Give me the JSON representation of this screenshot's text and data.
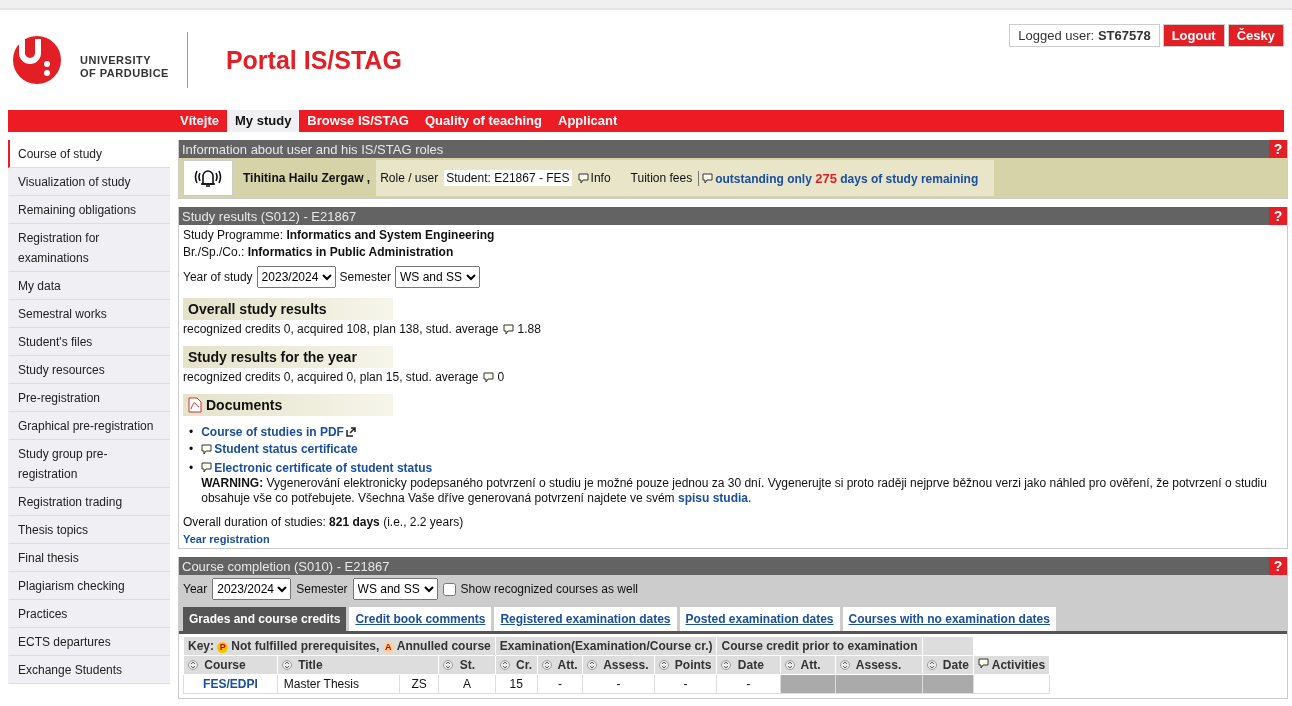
{
  "header": {
    "logo_text": [
      "UNIVERSITY",
      "OF PARDUBICE"
    ],
    "title": "Portal IS/STAG",
    "logged_label": "Logged user:",
    "logged_user": "ST67578",
    "buttons": [
      "Logout",
      "Česky"
    ]
  },
  "nav": [
    {
      "label": "Vítejte",
      "selected": false
    },
    {
      "label": "My study",
      "selected": true
    },
    {
      "label": "Browse IS/STAG",
      "selected": false
    },
    {
      "label": "Quality of teaching",
      "selected": false
    },
    {
      "label": "Applicant",
      "selected": false
    }
  ],
  "sidebar": [
    {
      "label": "Course of study",
      "selected": true
    },
    {
      "label": "Visualization of study",
      "selected": false
    },
    {
      "label": "Remaining obligations",
      "selected": false
    },
    {
      "label": "Registration for examinations",
      "selected": false
    },
    {
      "label": "My data",
      "selected": false
    },
    {
      "label": "Semestral works",
      "selected": false
    },
    {
      "label": "Student's files",
      "selected": false
    },
    {
      "label": "Study resources",
      "selected": false
    },
    {
      "label": "Pre-registration",
      "selected": false
    },
    {
      "label": "Graphical pre-registration",
      "selected": false
    },
    {
      "label": "Study group pre-registration",
      "selected": false
    },
    {
      "label": "Registration trading",
      "selected": false
    },
    {
      "label": "Thesis topics",
      "selected": false
    },
    {
      "label": "Final thesis",
      "selected": false
    },
    {
      "label": "Plagiarism checking",
      "selected": false
    },
    {
      "label": "Practices",
      "selected": false
    },
    {
      "label": "ECTS departures",
      "selected": false
    },
    {
      "label": "Exchange Students",
      "selected": false
    }
  ],
  "user_info": {
    "title": "Information about user and his IS/STAG roles",
    "help": "?",
    "name": "Tihitina Hailu Zergaw ,",
    "role_label": "Role / user",
    "role": "Student: E21867 - FES",
    "info": "Info",
    "fees_label": "Tuition fees",
    "fees_link": {
      "before": "outstanding only",
      "number": "275",
      "after": "days of study remaining"
    }
  },
  "study_results": {
    "title": "Study results (S012) - E21867",
    "help": "?",
    "programme": "Study Programme: **Informatics and System Engineering**",
    "branch": "Br./Sp./Co.: **Informatics in Public Administration**",
    "year_label": "Year of study",
    "year": "2023/2024",
    "semester_label": "Semester",
    "semester": "WS and SS",
    "overall": {
      "heading": "Overall study results",
      "text": "recognized credits 0, acquired 108, plan 138, stud. average",
      "value": "1.88"
    },
    "year_results": {
      "heading": "Study results for the year",
      "text": "recognized credits 0, acquired 0, plan 15, stud. average",
      "value": "0"
    },
    "documents": {
      "heading": "Documents",
      "items": [
        {
          "kind": "external",
          "bullet": "•",
          "label": "Course of studies in PDF"
        },
        {
          "kind": "comment",
          "bullet": "•",
          "label": "Student status certificate"
        },
        {
          "kind": "comment",
          "bullet": "•",
          "label": "Electronic certificate of student status"
        }
      ],
      "warning": {
        "text": "**WARNING:** Vygenerování elektronicky podepsaného potvrzení o studiu je možné pouze jednou za 30 dní. Vygenerujte si proto raději nejprve běžnou verzi jako náhled pro ověření, že potvrzení o studiu obsahuje vše co potřebujete. Všechna Vaše dříve generovaná potvrzení najdete ve svém",
        "link": "spisu studia",
        "after": "."
      }
    },
    "duration": "Overall duration of studies: **821 days** (i.e., 2.2 years)",
    "year_registration": "Year registration"
  },
  "course_completion": {
    "title": "Course completion (S010) - E21867",
    "help": "?",
    "year_label": "Year",
    "year": "2023/2024",
    "semester_label": "Semester",
    "semester": "WS and SS",
    "show_recognized": {
      "label": "Show recognized courses as well",
      "checked": false
    },
    "tabs": [
      {
        "label": "Grades and course credits",
        "selected": true
      },
      {
        "label": "Credit book comments",
        "selected": false
      },
      {
        "label": "Registered examination dates",
        "selected": false
      },
      {
        "label": "Posted examination dates",
        "selected": false
      },
      {
        "label": "Courses with no examination dates",
        "selected": false
      }
    ],
    "key": {
      "label": "Key:",
      "p_badge": "P",
      "p_text": "Not fulfilled prerequisites,",
      "a_badge": "A",
      "a_text": "Annulled course"
    },
    "groups": [
      "Examination(Examination/Course cr.)",
      "Course credit prior to examination"
    ],
    "columns": [
      "Course",
      "Title",
      "St.",
      "Cr.",
      "Att.",
      "Assess.",
      "Points",
      "Date",
      "Att.",
      "Assess.",
      "Date",
      "Activities"
    ],
    "rows": [
      {
        "course": "FES/EDPI",
        "title": "Master Thesis",
        "semester": "ZS",
        "status": "A",
        "credits": "15",
        "exam": [
          "-",
          "-",
          "-",
          "-"
        ]
      }
    ]
  }
}
